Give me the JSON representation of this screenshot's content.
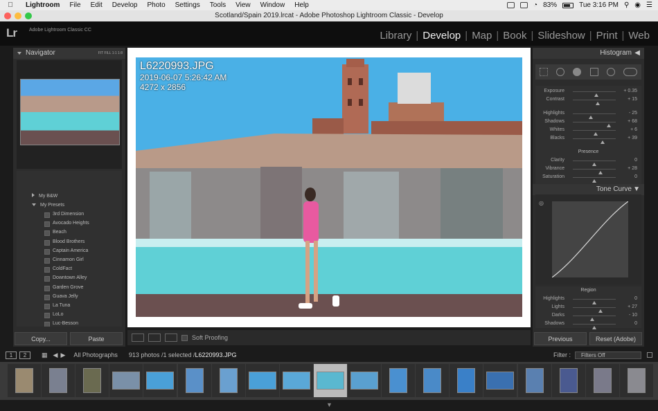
{
  "menubar": {
    "app": "Lightroom",
    "items": [
      "File",
      "Edit",
      "Develop",
      "Photo",
      "Settings",
      "Tools",
      "View",
      "Window",
      "Help"
    ],
    "battery": "83%",
    "clock": "Tue 3:16 PM"
  },
  "window": {
    "title": "Scotland/Spain 2019.lrcat - Adobe Photoshop Lightroom Classic - Develop"
  },
  "header": {
    "logo": "Lr",
    "brand": "Adobe Lightroom Classic CC",
    "modules": [
      "Library",
      "Develop",
      "Map",
      "Book",
      "Slideshow",
      "Print",
      "Web"
    ],
    "active": "Develop"
  },
  "navigator": {
    "title": "Navigator",
    "zoom": "FIT   FILL   1:1   1:8"
  },
  "presets": {
    "folders": [
      "My B&W",
      "My Presets"
    ],
    "items": [
      "3rd Dimension",
      "Avocado Heights",
      "Beach",
      "Blood Brothers",
      "Captain America",
      "Cinnamon Girl",
      "ColdFact",
      "Downtown Alley",
      "Garden Grove",
      "Guava Jelly",
      "La Tuna",
      "LoLo",
      "Luc-Besson"
    ]
  },
  "left_buttons": {
    "copy": "Copy...",
    "paste": "Paste"
  },
  "photo": {
    "filename": "L6220993.JPG",
    "date": "2019-06-07 5:26:42 AM",
    "dimensions": "4272 x 2856"
  },
  "toolbar": {
    "soft_proofing": "Soft Proofing"
  },
  "right": {
    "histogram": "Histogram",
    "basic": [
      {
        "label": "Exposure",
        "value": "+ 0.35",
        "level": 0.55
      },
      {
        "label": "Contrast",
        "value": "+ 15",
        "level": 0.58
      }
    ],
    "tone": [
      {
        "label": "Highlights",
        "value": "- 25",
        "level": 0.42
      },
      {
        "label": "Shadows",
        "value": "+ 68",
        "level": 0.84
      },
      {
        "label": "Whites",
        "value": "+ 6",
        "level": 0.53
      },
      {
        "label": "Blacks",
        "value": "+ 39",
        "level": 0.7
      }
    ],
    "presence_title": "Presence",
    "presence": [
      {
        "label": "Clarity",
        "value": "0",
        "level": 0.5
      },
      {
        "label": "Vibrance",
        "value": "+ 28",
        "level": 0.64
      },
      {
        "label": "Saturation",
        "value": "0",
        "level": 0.5
      }
    ],
    "tone_curve": "Tone Curve",
    "region_title": "Region",
    "region": [
      {
        "label": "Highlights",
        "value": "0",
        "level": 0.5
      },
      {
        "label": "Lights",
        "value": "+ 27",
        "level": 0.64
      },
      {
        "label": "Darks",
        "value": "- 10",
        "level": 0.45
      },
      {
        "label": "Shadows",
        "value": "0",
        "level": 0.5
      }
    ],
    "previous": "Previous",
    "reset": "Reset (Adobe)"
  },
  "filmstrip_bar": {
    "page1": "1",
    "page2": "2",
    "source": "All Photographs",
    "count": "913 photos /1 selected /",
    "selected_file": "L6220993.JPG",
    "filter_label": "Filter :",
    "filter_value": "Filters Off"
  },
  "colors": {
    "accent": "#eeeeee",
    "panel": "#2c2c2c",
    "sky": "#4ab0e6",
    "water": "#5fd0d6"
  }
}
